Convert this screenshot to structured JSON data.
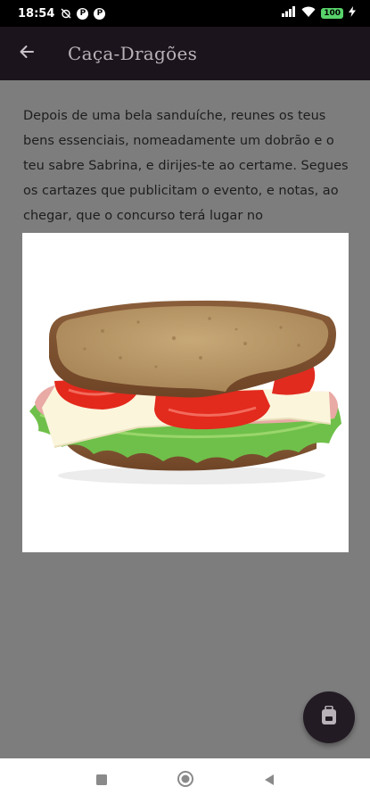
{
  "status_bar": {
    "time": "18:54",
    "battery_level": "100"
  },
  "app_bar": {
    "title": "Caça-Dragões"
  },
  "story": {
    "text": "Depois de uma bela sanduíche, reunes os teus bens essenciais, nomeadamente um dobrão e o teu sabre Sabrina, e dirijes-te ao certame. Segues os cartazes que publicitam o evento, e notas, ao chegar, que o concurso terá lugar no"
  },
  "colors": {
    "app_bar_bg": "#1c141c",
    "page_bg": "#7d7d7d",
    "fab_bg": "#231b23",
    "battery": "#58d36b"
  },
  "icons": {
    "back": "arrow-left-icon",
    "fab": "backpack-icon",
    "nav_recents": "square-icon",
    "nav_home": "circle-icon",
    "nav_back": "triangle-icon"
  }
}
